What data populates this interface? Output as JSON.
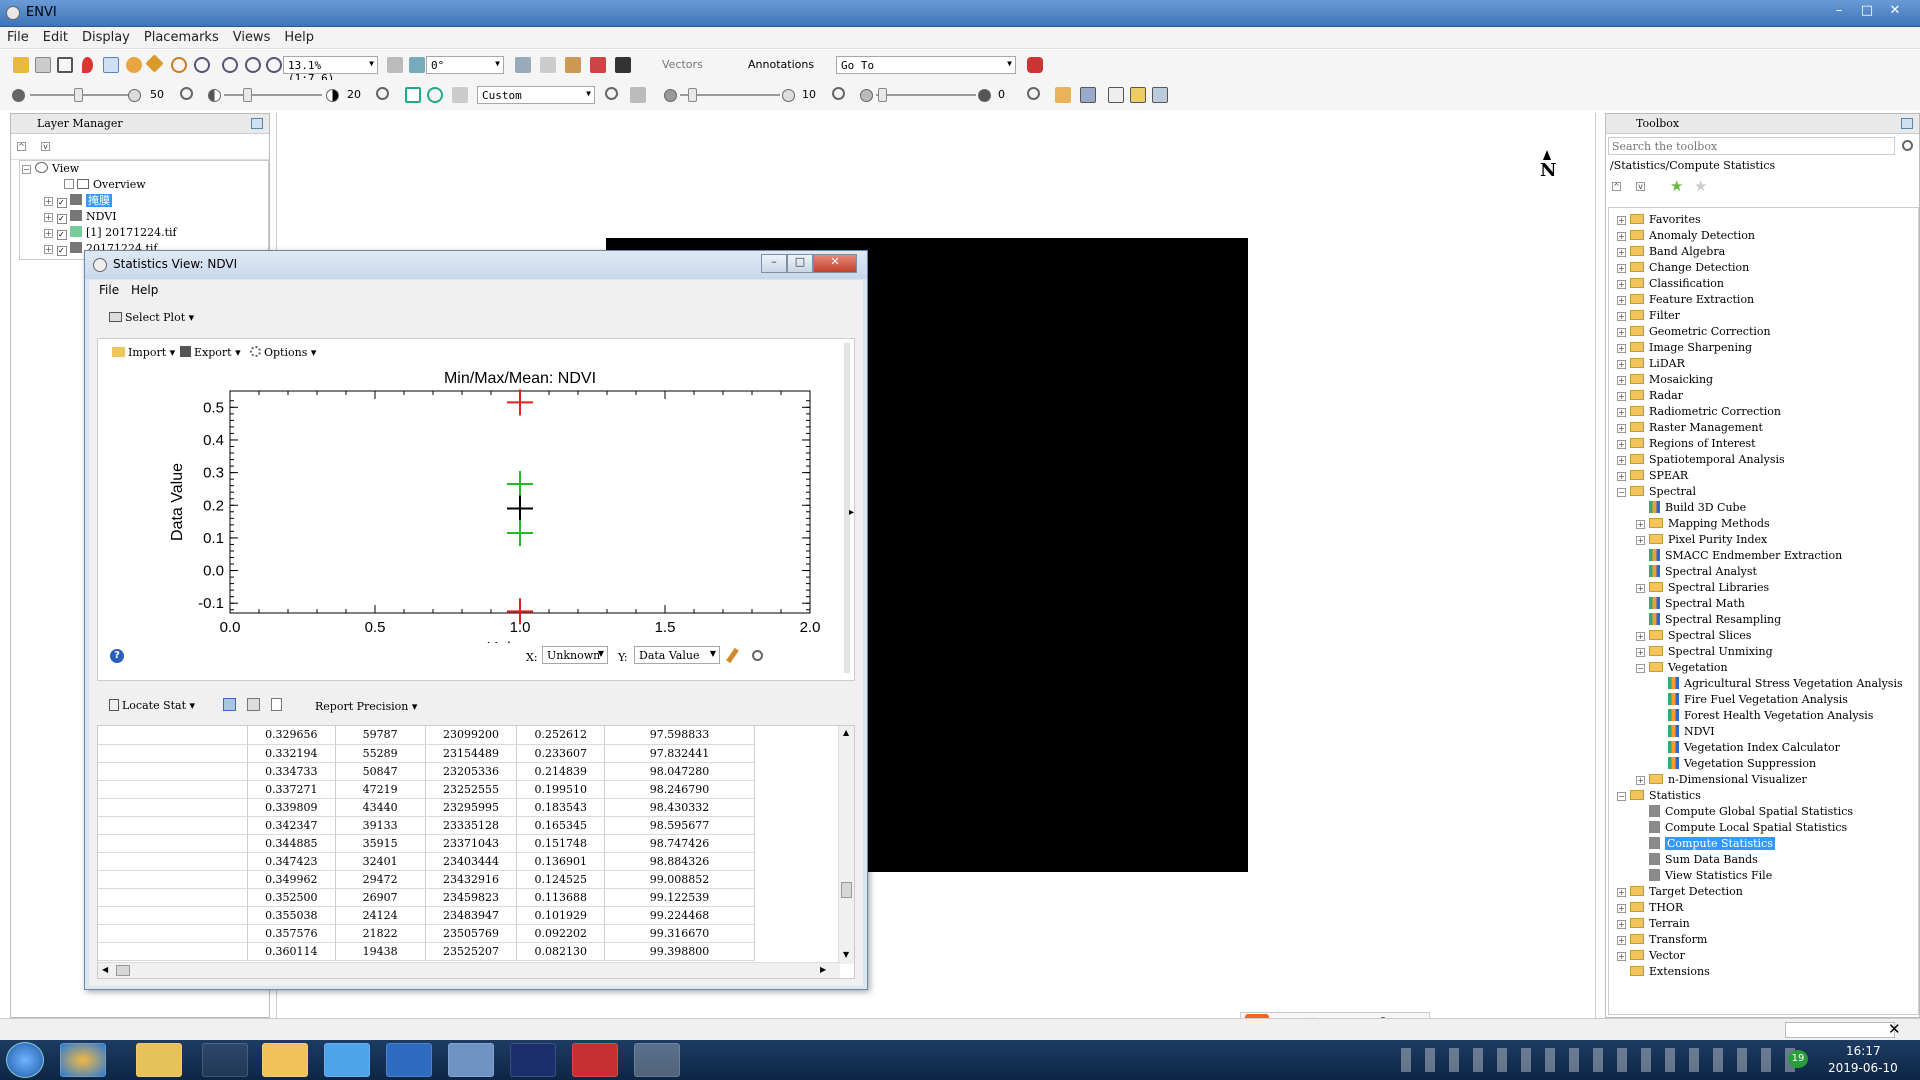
{
  "app": {
    "title": "ENVI",
    "icon": "envi-icon"
  },
  "menu": [
    "File",
    "Edit",
    "Display",
    "Placemarks",
    "Views",
    "Help"
  ],
  "toolbar1": {
    "zoom": "13.1% (1:7.6)",
    "rotation": "0°",
    "vectors": "Vectors",
    "annotations": "Annotations",
    "goto": "Go To"
  },
  "toolbar2": {
    "brightness": "50",
    "contrast": "20",
    "stretch": "Custom",
    "sharpen": "10",
    "transparency": "0"
  },
  "layer_manager": {
    "title": "Layer Manager",
    "items": [
      "View",
      "Overview",
      "掩膜",
      "NDVI",
      "[1] 20171224.tif",
      "20171224.tif"
    ]
  },
  "stat_window": {
    "title": "Statistics View: NDVI",
    "menu": [
      "File",
      "Help"
    ],
    "select_plot": "Select Plot",
    "import": "Import",
    "export": "Export",
    "options": "Options",
    "x_label_sel": "X:",
    "x_value": "Unknown",
    "y_label_sel": "Y:",
    "y_value": "Data Value",
    "locate_stat": "Locate Stat",
    "report_precision": "Report Precision",
    "rows": [
      [
        "0.329656",
        "59787",
        "23099200",
        "0.252612",
        "97.598833"
      ],
      [
        "0.332194",
        "55289",
        "23154489",
        "0.233607",
        "97.832441"
      ],
      [
        "0.334733",
        "50847",
        "23205336",
        "0.214839",
        "98.047280"
      ],
      [
        "0.337271",
        "47219",
        "23252555",
        "0.199510",
        "98.246790"
      ],
      [
        "0.339809",
        "43440",
        "23295995",
        "0.183543",
        "98.430332"
      ],
      [
        "0.342347",
        "39133",
        "23335128",
        "0.165345",
        "98.595677"
      ],
      [
        "0.344885",
        "35915",
        "23371043",
        "0.151748",
        "98.747426"
      ],
      [
        "0.347423",
        "32401",
        "23403444",
        "0.136901",
        "98.884326"
      ],
      [
        "0.349962",
        "29472",
        "23432916",
        "0.124525",
        "99.008852"
      ],
      [
        "0.352500",
        "26907",
        "23459823",
        "0.113688",
        "99.122539"
      ],
      [
        "0.355038",
        "24124",
        "23483947",
        "0.101929",
        "99.224468"
      ],
      [
        "0.357576",
        "21822",
        "23505769",
        "0.092202",
        "99.316670"
      ],
      [
        "0.360114",
        "19438",
        "23525207",
        "0.082130",
        "99.398800"
      ]
    ]
  },
  "chart_data": {
    "type": "scatter",
    "title": "Min/Max/Mean: NDVI",
    "xlabel": "Unknown",
    "ylabel": "Data Value",
    "xlim": [
      0,
      2
    ],
    "ylim": [
      -0.13,
      0.55
    ],
    "xticks": [
      "0.0",
      "0.5",
      "1.0",
      "1.5",
      "2.0"
    ],
    "yticks": [
      "-0.1",
      "0.0",
      "0.1",
      "0.2",
      "0.3",
      "0.4",
      "0.5"
    ],
    "points": [
      {
        "x": 1.0,
        "y": 0.515,
        "color": "#e02020"
      },
      {
        "x": 1.0,
        "y": 0.265,
        "color": "#22b822"
      },
      {
        "x": 1.0,
        "y": 0.19,
        "color": "#000000"
      },
      {
        "x": 1.0,
        "y": 0.115,
        "color": "#22b822"
      },
      {
        "x": 1.0,
        "y": -0.125,
        "color": "#e02020"
      }
    ]
  },
  "toolbox": {
    "title": "Toolbox",
    "search_placeholder": "Search the toolbox",
    "path": "/Statistics/Compute Statistics",
    "items": [
      {
        "t": "Favorites",
        "l": 0,
        "k": "f"
      },
      {
        "t": "Anomaly Detection",
        "l": 0,
        "k": "f"
      },
      {
        "t": "Band Algebra",
        "l": 0,
        "k": "f"
      },
      {
        "t": "Change Detection",
        "l": 0,
        "k": "f"
      },
      {
        "t": "Classification",
        "l": 0,
        "k": "f"
      },
      {
        "t": "Feature Extraction",
        "l": 0,
        "k": "f"
      },
      {
        "t": "Filter",
        "l": 0,
        "k": "f"
      },
      {
        "t": "Geometric Correction",
        "l": 0,
        "k": "f"
      },
      {
        "t": "Image Sharpening",
        "l": 0,
        "k": "f"
      },
      {
        "t": "LiDAR",
        "l": 0,
        "k": "f"
      },
      {
        "t": "Mosaicking",
        "l": 0,
        "k": "f"
      },
      {
        "t": "Radar",
        "l": 0,
        "k": "f"
      },
      {
        "t": "Radiometric Correction",
        "l": 0,
        "k": "f"
      },
      {
        "t": "Raster Management",
        "l": 0,
        "k": "f"
      },
      {
        "t": "Regions of Interest",
        "l": 0,
        "k": "f"
      },
      {
        "t": "Spatiotemporal Analysis",
        "l": 0,
        "k": "f"
      },
      {
        "t": "SPEAR",
        "l": 0,
        "k": "f"
      },
      {
        "t": "Spectral",
        "l": 0,
        "k": "o"
      },
      {
        "t": "Build 3D Cube",
        "l": 1,
        "k": "t"
      },
      {
        "t": "Mapping Methods",
        "l": 1,
        "k": "f"
      },
      {
        "t": "Pixel Purity Index",
        "l": 1,
        "k": "f"
      },
      {
        "t": "SMACC Endmember Extraction",
        "l": 1,
        "k": "t"
      },
      {
        "t": "Spectral Analyst",
        "l": 1,
        "k": "t"
      },
      {
        "t": "Spectral Libraries",
        "l": 1,
        "k": "f"
      },
      {
        "t": "Spectral Math",
        "l": 1,
        "k": "t"
      },
      {
        "t": "Spectral Resampling",
        "l": 1,
        "k": "t"
      },
      {
        "t": "Spectral Slices",
        "l": 1,
        "k": "f"
      },
      {
        "t": "Spectral Unmixing",
        "l": 1,
        "k": "f"
      },
      {
        "t": "Vegetation",
        "l": 1,
        "k": "o"
      },
      {
        "t": "Agricultural Stress Vegetation Analysis",
        "l": 2,
        "k": "t"
      },
      {
        "t": "Fire Fuel Vegetation Analysis",
        "l": 2,
        "k": "t"
      },
      {
        "t": "Forest Health Vegetation Analysis",
        "l": 2,
        "k": "t"
      },
      {
        "t": "NDVI",
        "l": 2,
        "k": "t"
      },
      {
        "t": "Vegetation Index Calculator",
        "l": 2,
        "k": "t"
      },
      {
        "t": "Vegetation Suppression",
        "l": 2,
        "k": "t"
      },
      {
        "t": "n-Dimensional Visualizer",
        "l": 1,
        "k": "f"
      },
      {
        "t": "Statistics",
        "l": 0,
        "k": "o"
      },
      {
        "t": "Compute Global Spatial Statistics",
        "l": 1,
        "k": "s"
      },
      {
        "t": "Compute Local Spatial Statistics",
        "l": 1,
        "k": "s"
      },
      {
        "t": "Compute Statistics",
        "l": 1,
        "k": "sel"
      },
      {
        "t": "Sum Data Bands",
        "l": 1,
        "k": "s"
      },
      {
        "t": "View Statistics File",
        "l": 1,
        "k": "s"
      },
      {
        "t": "Target Detection",
        "l": 0,
        "k": "f"
      },
      {
        "t": "THOR",
        "l": 0,
        "k": "f"
      },
      {
        "t": "Terrain",
        "l": 0,
        "k": "f"
      },
      {
        "t": "Transform",
        "l": 0,
        "k": "f"
      },
      {
        "t": "Vector",
        "l": 0,
        "k": "f"
      },
      {
        "t": "Extensions",
        "l": 0,
        "k": "fn"
      }
    ]
  },
  "north_arrow": "N",
  "ime": {
    "lang": "中",
    "punct": "°,"
  },
  "clock": {
    "time": "16:17",
    "date": "2019-06-10",
    "badge": "19"
  },
  "colors": {
    "titlebar": "#4a7fc1",
    "selection": "#3399ff",
    "image": "#000000"
  }
}
